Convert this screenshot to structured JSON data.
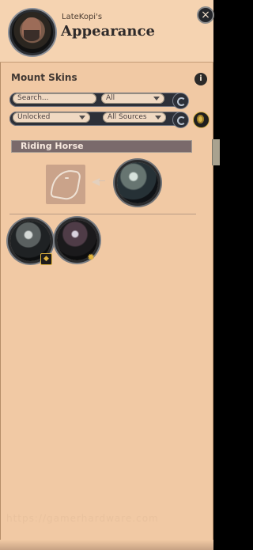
{
  "header": {
    "player_name": "LateKopi's",
    "title": "Appearance",
    "close_icon": "×"
  },
  "section": {
    "title": "Mount Skins",
    "info_icon": "i"
  },
  "filters": {
    "search_placeholder": "Search...",
    "type_value": "All",
    "lock_value": "Unlocked",
    "source_value": "All Sources"
  },
  "category": {
    "label": "Riding Horse"
  },
  "badges": {
    "shield": "◆",
    "star": "✹"
  },
  "watermark": {
    "text": "https://gamerhardware.com"
  }
}
